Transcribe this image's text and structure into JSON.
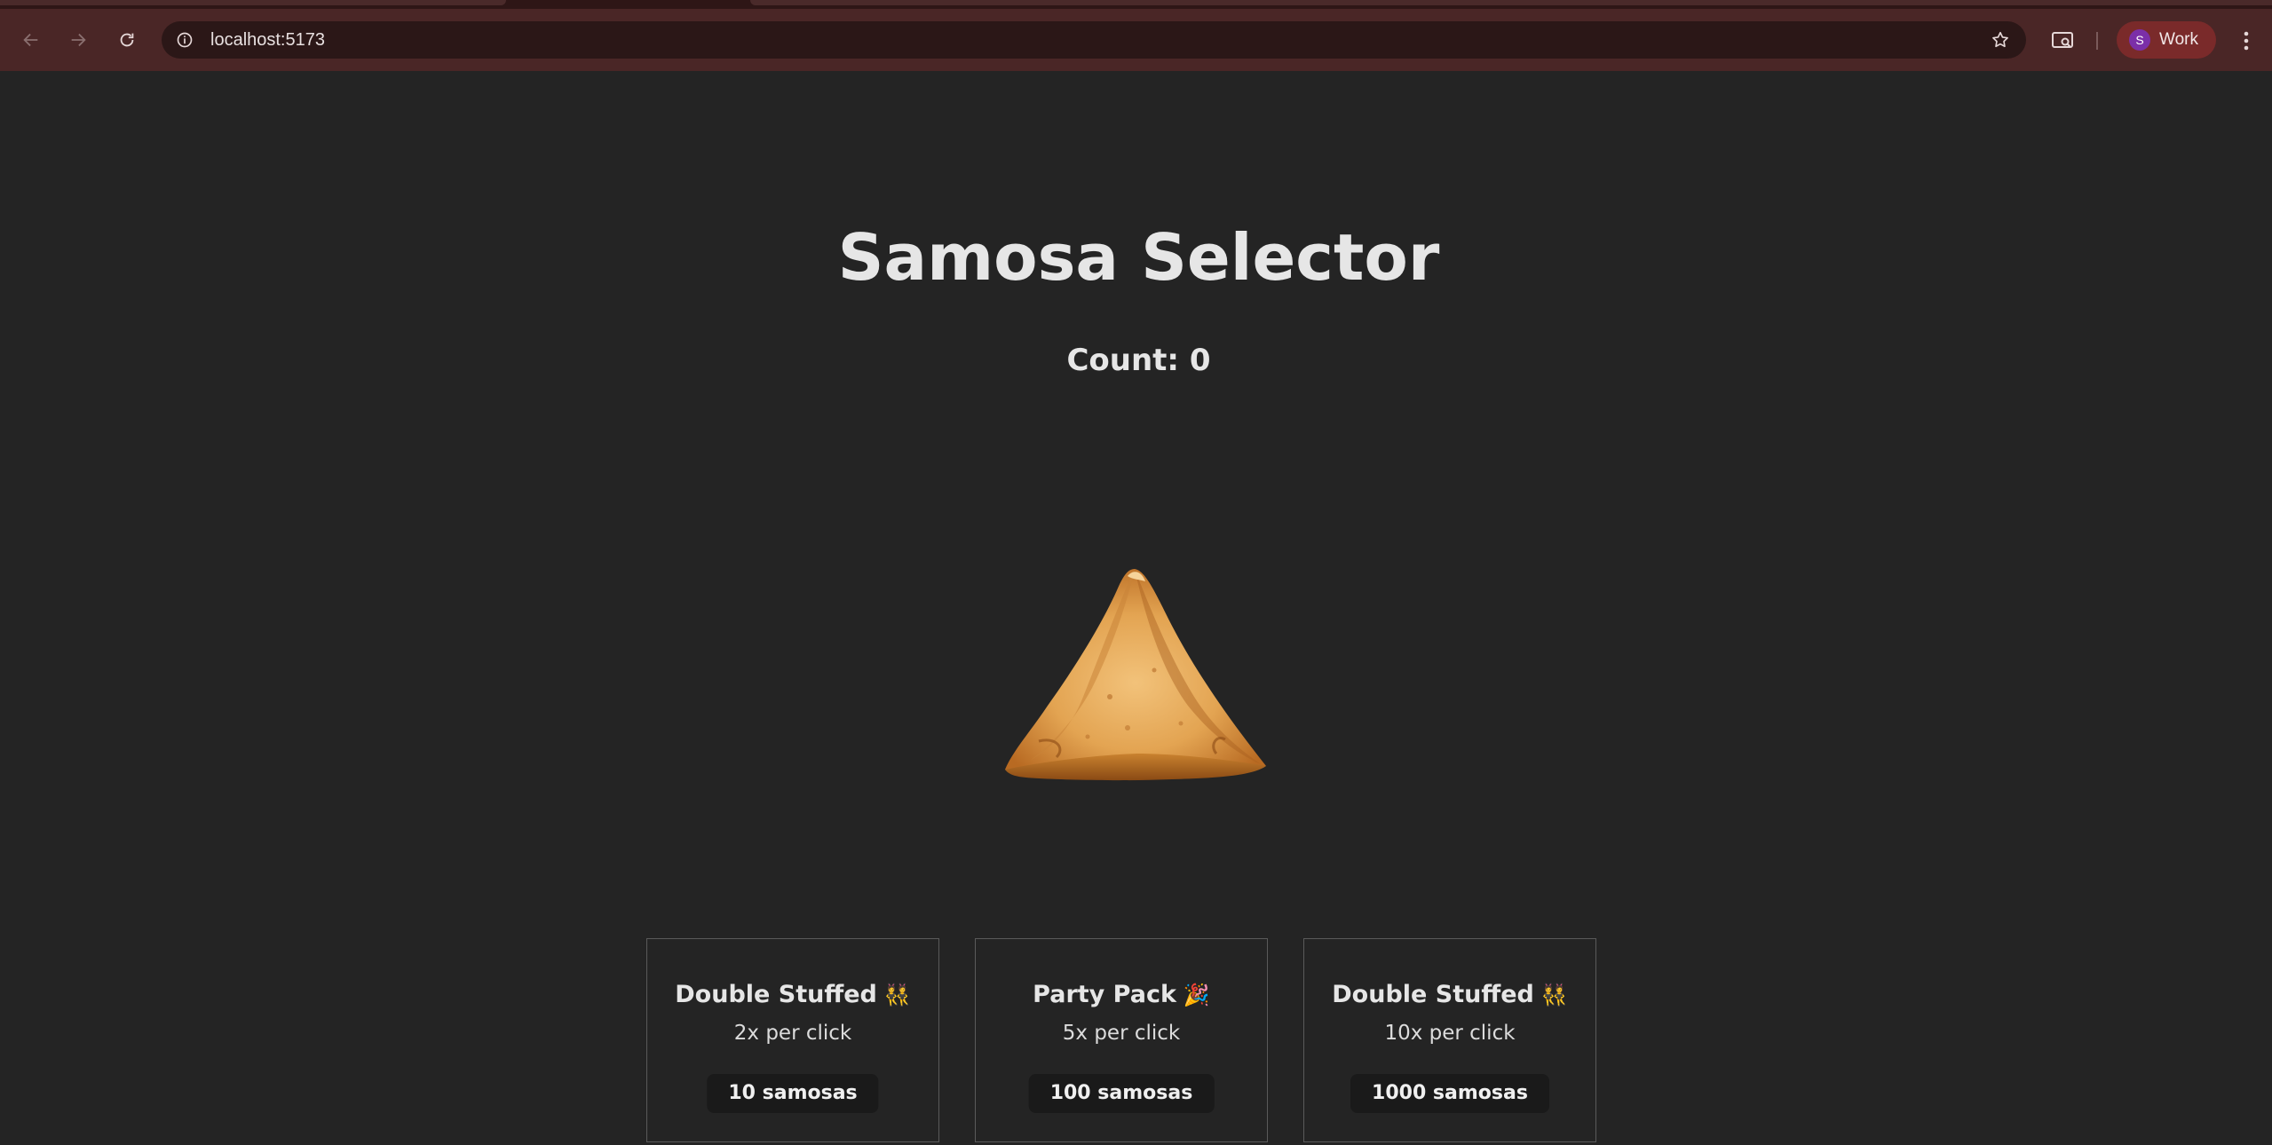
{
  "browser": {
    "url": "localhost:5173",
    "profile_initial": "S",
    "profile_label": "Work",
    "colors": {
      "toolbar": "#4a2626",
      "omnibox": "#2b1717",
      "profile_chip": "#7a2a2a",
      "avatar": "#7b2fa8"
    },
    "icons": [
      "back-arrow-icon",
      "forward-arrow-icon",
      "reload-icon",
      "site-info-icon",
      "bookmark-star-icon",
      "reading-mode-icon",
      "kebab-menu-icon"
    ]
  },
  "page": {
    "title": "Samosa Selector",
    "count_label": "Count: 0",
    "background": "#242424"
  },
  "upgrades": [
    {
      "name": "Double Stuffed",
      "emoji": "👯",
      "description": "2x per click",
      "price_label": "10 samosas"
    },
    {
      "name": "Party Pack",
      "emoji": "🎉",
      "description": "5x per click",
      "price_label": "100 samosas"
    },
    {
      "name": "Double Stuffed",
      "emoji": "👯",
      "description": "10x per click",
      "price_label": "1000 samosas"
    }
  ]
}
